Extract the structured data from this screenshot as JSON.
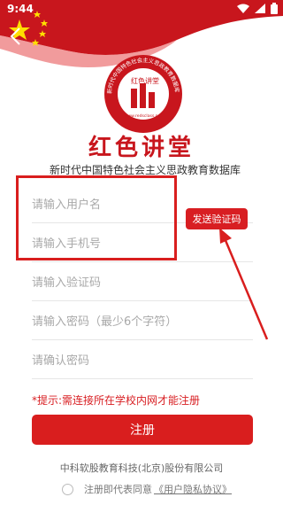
{
  "status": {
    "time": "9:44"
  },
  "brand": {
    "logo_text": "红色讲堂",
    "logo_url": "www.redsclass.net",
    "logo_ring_text": "新时代中国特色社会主义思政教育数据库",
    "title": "红色讲堂",
    "subtitle": "新时代中国特色社会主义思政教育数据库"
  },
  "form": {
    "username_placeholder": "请输入用户名",
    "phone_placeholder": "请输入手机号",
    "code_placeholder": "请输入验证码",
    "password_placeholder": "请输入密码（最少6个字符）",
    "confirm_placeholder": "请确认密码",
    "send_code_label": "发送验证码"
  },
  "hint": "*提示:需连接所在学校内网才能注册",
  "register_label": "注册",
  "company": "中科软股教育科技(北京)股份有限公司",
  "agreement": {
    "text": "注册即代表同意",
    "link": "《用户隐私协议》"
  },
  "colors": {
    "accent": "#d81e22",
    "flag": "#c8161d",
    "star": "#ffde00"
  }
}
